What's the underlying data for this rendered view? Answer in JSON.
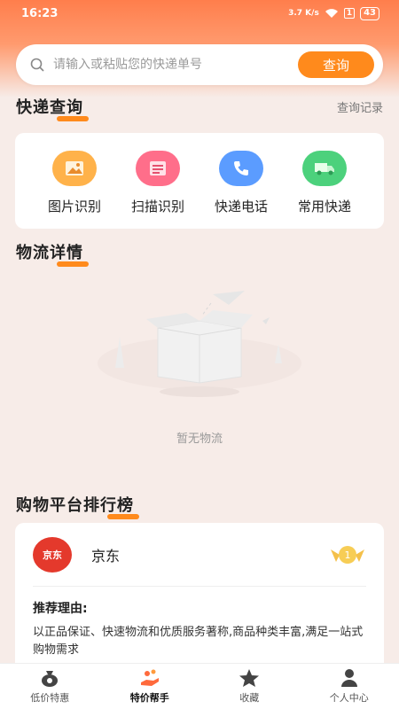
{
  "status_bar": {
    "time": "16:23",
    "speed": "3.7 K/s",
    "battery": "43"
  },
  "search": {
    "placeholder": "请输入或粘贴您的快递单号",
    "button": "查询"
  },
  "express_section": {
    "title": "快递查询",
    "history_link": "查询记录"
  },
  "tools": [
    {
      "label": "图片识别",
      "icon": "image-icon",
      "color": "#ffb24a"
    },
    {
      "label": "扫描识别",
      "icon": "scan-icon",
      "color": "#ff6e8a"
    },
    {
      "label": "快递电话",
      "icon": "phone-icon",
      "color": "#5b9cff"
    },
    {
      "label": "常用快递",
      "icon": "truck-icon",
      "color": "#4cd17c"
    }
  ],
  "logistics_section": {
    "title": "物流详情",
    "empty_text": "暂无物流"
  },
  "ranking_section": {
    "title": "购物平台排行榜",
    "platform": {
      "name": "京东",
      "logo_text": "京东",
      "rank": "1",
      "reason_title": "推荐理由:",
      "reason_text": "以正品保证、快速物流和优质服务著称,商品种类丰富,满足一站式购物需求"
    }
  },
  "tabs": [
    {
      "label": "低价特惠",
      "icon": "moneybag-icon",
      "active": false
    },
    {
      "label": "特价帮手",
      "icon": "hand-coin-icon",
      "active": true
    },
    {
      "label": "收藏",
      "icon": "star-icon",
      "active": false
    },
    {
      "label": "个人中心",
      "icon": "user-icon",
      "active": false
    }
  ],
  "colors": {
    "accent": "#ff8a1c",
    "header": "#ff7e4c",
    "background": "#f7ece8"
  }
}
